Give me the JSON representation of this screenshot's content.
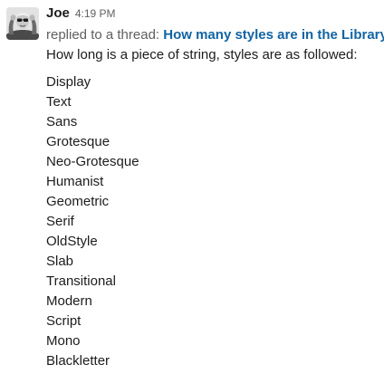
{
  "message": {
    "author": "Joe",
    "timestamp": "4:19 PM",
    "thread_prefix": "replied to a thread: ",
    "thread_title": "How many styles are in the Library?",
    "intro": "How long is a piece of string, styles are as followed:",
    "styles": [
      "Display",
      "Text",
      "Sans",
      "Grotesque",
      "Neo-Grotesque",
      "Humanist",
      "Geometric",
      "Serif",
      "OldStyle",
      "Slab",
      "Transitional",
      "Modern",
      "Script",
      "Mono",
      "Blackletter"
    ]
  },
  "colors": {
    "link": "#1264a3",
    "muted": "#616061",
    "text": "#1d1c1d"
  }
}
